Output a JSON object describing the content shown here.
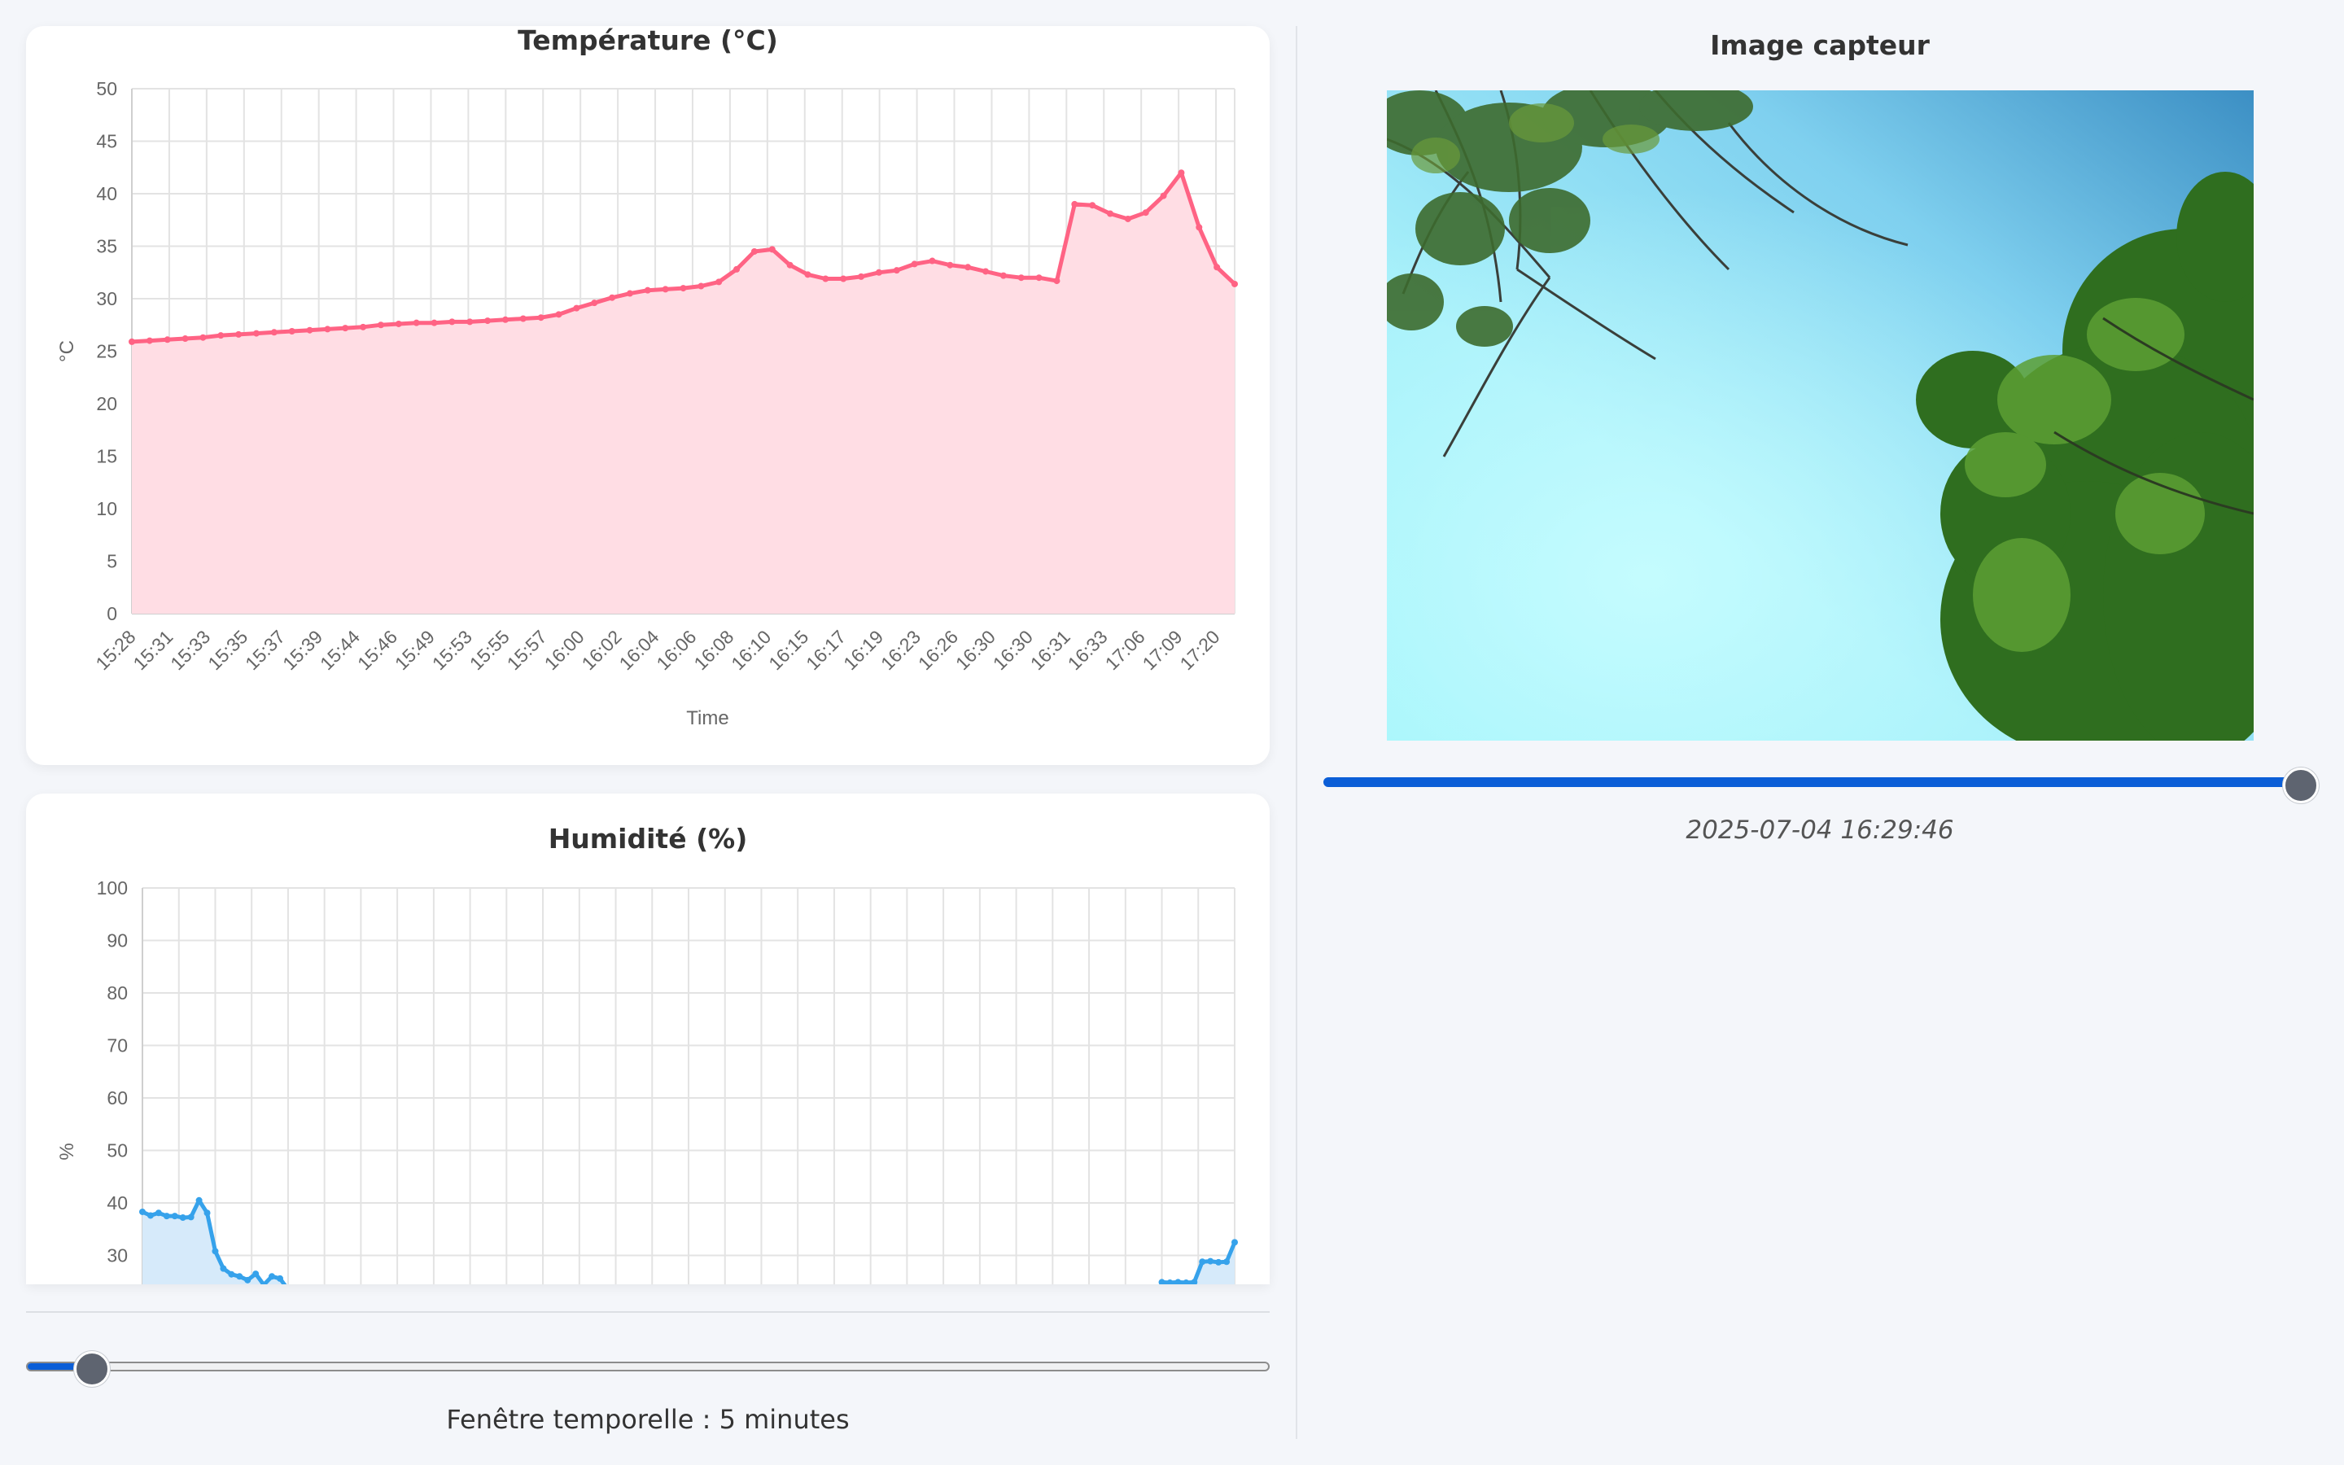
{
  "temperature_chart": {
    "title": "Température (°C)",
    "xlabel": "Time",
    "ylabel": "°C",
    "line_color": "#ff6384",
    "fill_color": "#ffdde4"
  },
  "humidity_chart": {
    "title": "Humidité (%)",
    "ylabel": "%",
    "line_color": "#36a2eb",
    "fill_color": "#d6eafa"
  },
  "window_slider": {
    "label": "Fenêtre temporelle : 5 minutes",
    "value_fraction": 0.03,
    "accent": "#0b5ed7"
  },
  "image_panel": {
    "title": "Image capteur",
    "timestamp": "2025-07-04 16:29:46",
    "slider_value_fraction": 1.0,
    "image_description_icon": "sensor-photo"
  },
  "chart_data": [
    {
      "type": "area",
      "title": "Température (°C)",
      "xlabel": "Time",
      "ylabel": "°C",
      "ylim": [
        0,
        50
      ],
      "yticks": [
        0,
        5,
        10,
        15,
        20,
        25,
        30,
        35,
        40,
        45,
        50
      ],
      "grid": true,
      "x_tick_labels": [
        "15:28",
        "15:31",
        "15:33",
        "15:35",
        "15:37",
        "15:39",
        "15:44",
        "15:46",
        "15:49",
        "15:53",
        "15:55",
        "15:57",
        "16:00",
        "16:02",
        "16:04",
        "16:06",
        "16:08",
        "16:10",
        "16:15",
        "16:17",
        "16:19",
        "16:23",
        "16:26",
        "16:30",
        "16:30",
        "16:31",
        "16:33",
        "17:06",
        "17:09",
        "17:20"
      ],
      "series": [
        {
          "values": [
            25.9,
            26.0,
            26.1,
            26.2,
            26.3,
            26.5,
            26.6,
            26.7,
            26.8,
            26.9,
            27.0,
            27.1,
            27.2,
            27.3,
            27.5,
            27.6,
            27.7,
            27.7,
            27.8,
            27.8,
            27.9,
            28.0,
            28.1,
            28.2,
            28.5,
            29.1,
            29.6,
            30.1,
            30.5,
            30.8,
            30.9,
            31.0,
            31.2,
            31.6,
            32.8,
            34.5,
            34.7,
            33.2,
            32.3,
            31.9,
            31.9,
            32.1,
            32.5,
            32.7,
            33.3,
            33.6,
            33.2,
            33.0,
            32.6,
            32.2,
            32.0,
            32.0,
            31.7,
            39.0,
            38.9,
            38.1,
            37.6,
            38.2,
            39.8,
            42.0,
            36.8,
            33.0,
            31.4
          ]
        }
      ]
    },
    {
      "type": "area",
      "title": "Humidité (%)",
      "ylabel": "%",
      "ylim": [
        0,
        100
      ],
      "yticks_visible": [
        30,
        40,
        50,
        60,
        70,
        80,
        90,
        100
      ],
      "grid": true,
      "series": [
        {
          "values": [
            38.3,
            37.6,
            38.1,
            37.5,
            37.5,
            37.2,
            37.3,
            40.5,
            38.1,
            30.8,
            27.5,
            26.4,
            26.0,
            25.3,
            26.5,
            24.4,
            26.0,
            25.6,
            23.5,
            null,
            null,
            null,
            null,
            null,
            null,
            null,
            null,
            null,
            null,
            null,
            null,
            null,
            null,
            null,
            null,
            null,
            null,
            null,
            null,
            null,
            null,
            null,
            null,
            null,
            null,
            null,
            null,
            null,
            null,
            null,
            null,
            null,
            null,
            null,
            null,
            null,
            null,
            null,
            null,
            null,
            null,
            null,
            null,
            null,
            null,
            null,
            null,
            null,
            null,
            null,
            null,
            null,
            null,
            null,
            null,
            null,
            null,
            null,
            null,
            null,
            null,
            null,
            null,
            null,
            null,
            null,
            null,
            null,
            null,
            null,
            null,
            null,
            null,
            null,
            null,
            null,
            null,
            null,
            null,
            null,
            null,
            null,
            null,
            null,
            null,
            null,
            null,
            null,
            null,
            null,
            null,
            null,
            null,
            null,
            null,
            null,
            null,
            null,
            null,
            null,
            null,
            null,
            null,
            null,
            null,
            null,
            24.9,
            24.8,
            24.9,
            24.8,
            24.9,
            28.8,
            28.9,
            28.7,
            28.8,
            32.5
          ]
        }
      ]
    }
  ]
}
